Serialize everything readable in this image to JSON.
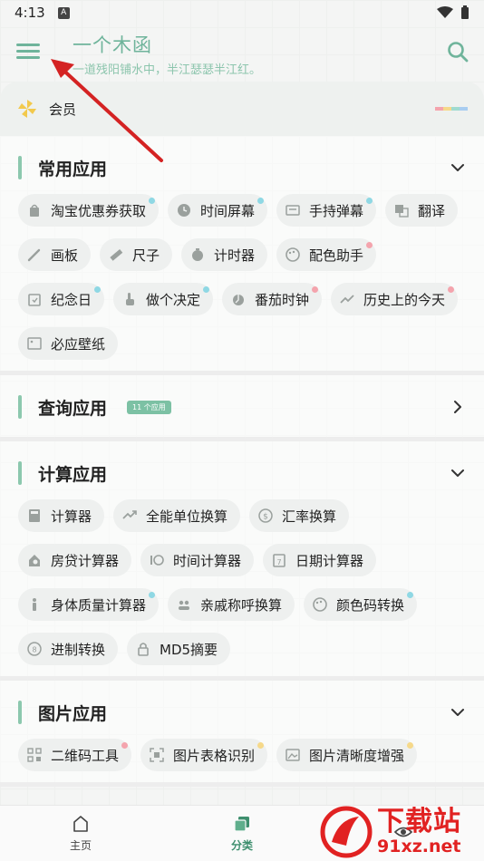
{
  "status_bar": {
    "time": "4:13",
    "badge": "A"
  },
  "header": {
    "title": "一个木函",
    "subtitle": "一道残阳铺水中，半江瑟瑟半江红。",
    "menu_icon": "hamburger-menu-icon",
    "search_icon": "search-icon"
  },
  "member": {
    "label": "会员",
    "icon": "pinwheel-icon",
    "stripe_colors": [
      "#f4a4ad",
      "#f6d98a",
      "#9fdbd0",
      "#a8cdf0"
    ]
  },
  "sections": [
    {
      "title": "常用应用",
      "chips": [
        {
          "label": "淘宝优惠券获取",
          "icon": "bag-icon",
          "dot": "#8fd8e4"
        },
        {
          "label": "时间屏幕",
          "icon": "clock-icon",
          "dot": "#8fd8e4"
        },
        {
          "label": "手持弹幕",
          "icon": "danmaku-icon",
          "dot": "#8fd8e4"
        },
        {
          "label": "翻译",
          "icon": "translate-icon",
          "dot": ""
        },
        {
          "label": "画板",
          "icon": "brush-icon",
          "dot": ""
        },
        {
          "label": "尺子",
          "icon": "ruler-icon",
          "dot": ""
        },
        {
          "label": "计时器",
          "icon": "stopwatch-icon",
          "dot": ""
        },
        {
          "label": "配色助手",
          "icon": "palette-icon",
          "dot": "#f4a4ad"
        },
        {
          "label": "纪念日",
          "icon": "calendar-icon",
          "dot": "#8fd8e4"
        },
        {
          "label": "做个决定",
          "icon": "pointer-hand-icon",
          "dot": "#8fd8e4"
        },
        {
          "label": "番茄时钟",
          "icon": "tomato-timer-icon",
          "dot": "#f4a4ad"
        },
        {
          "label": "历史上的今天",
          "icon": "trend-icon",
          "dot": "#f4a4ad"
        },
        {
          "label": "必应壁纸",
          "icon": "image-icon",
          "dot": ""
        }
      ]
    },
    {
      "title": "查询应用",
      "badge": "11 个应用",
      "collapsed": true,
      "chips": []
    },
    {
      "title": "计算应用",
      "chips": [
        {
          "label": "计算器",
          "icon": "calculator-icon",
          "dot": ""
        },
        {
          "label": "全能单位换算",
          "icon": "convert-icon",
          "dot": ""
        },
        {
          "label": "汇率换算",
          "icon": "currency-icon",
          "dot": ""
        },
        {
          "label": "房贷计算器",
          "icon": "house-search-icon",
          "dot": ""
        },
        {
          "label": "时间计算器",
          "icon": "time-calc-icon",
          "dot": ""
        },
        {
          "label": "日期计算器",
          "icon": "date-calc-icon",
          "dot": ""
        },
        {
          "label": "身体质量计算器",
          "icon": "body-icon",
          "dot": "#8fd8e4"
        },
        {
          "label": "亲戚称呼换算",
          "icon": "people-icon",
          "dot": ""
        },
        {
          "label": "颜色码转换",
          "icon": "palette-icon",
          "dot": "#8fd8e4"
        },
        {
          "label": "进制转换",
          "icon": "base-convert-icon",
          "dot": ""
        },
        {
          "label": "MD5摘要",
          "icon": "lock-icon",
          "dot": ""
        }
      ]
    },
    {
      "title": "图片应用",
      "chips": [
        {
          "label": "二维码工具",
          "icon": "qrcode-icon",
          "dot": "#f4a4ad"
        },
        {
          "label": "图片表格识别",
          "icon": "scan-table-icon",
          "dot": "#f6d98a"
        },
        {
          "label": "图片清晰度增强",
          "icon": "image-enhance-icon",
          "dot": "#f6d98a"
        }
      ]
    }
  ],
  "bottom_nav": [
    {
      "label": "主页",
      "icon": "home-icon",
      "active": false
    },
    {
      "label": "分类",
      "icon": "category-icon",
      "active": true
    },
    {
      "label": "",
      "icon": "eye-icon",
      "active": false
    }
  ],
  "watermark": {
    "big": "下载站",
    "small": "91xz.net"
  },
  "colors": {
    "accent": "#6fb49b",
    "section_bar": "#8cc8ae",
    "badge": "#7cc1a4",
    "arrow": "#d42323"
  }
}
